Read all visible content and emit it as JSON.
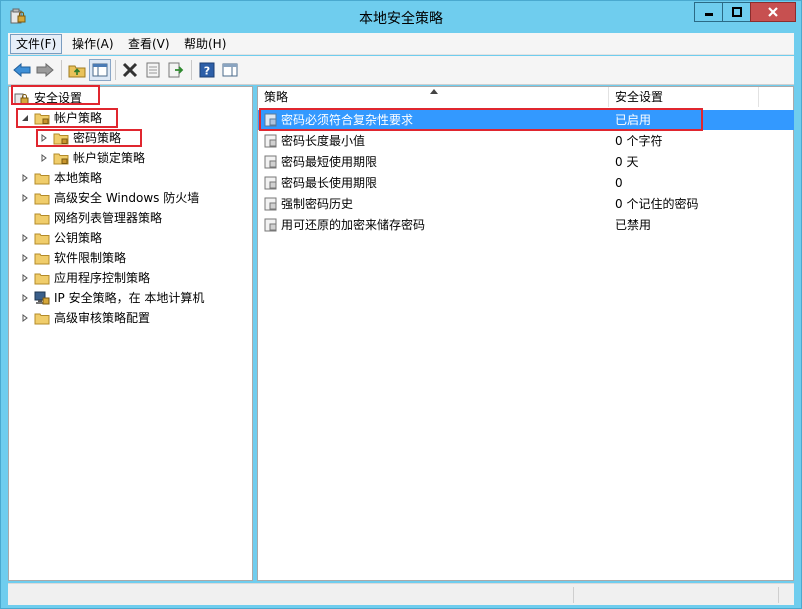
{
  "window": {
    "title": "本地安全策略"
  },
  "menu": [
    {
      "label": "文件(F)",
      "active": true
    },
    {
      "label": "操作(A)",
      "active": false
    },
    {
      "label": "查看(V)",
      "active": false
    },
    {
      "label": "帮助(H)",
      "active": false
    }
  ],
  "tree": {
    "root": "安全设置",
    "items": [
      {
        "label": "帐户策略",
        "expanded": true,
        "level": 1
      },
      {
        "label": "密码策略",
        "expanded": false,
        "level": 2,
        "selected": true
      },
      {
        "label": "帐户锁定策略",
        "expanded": false,
        "level": 2
      },
      {
        "label": "本地策略",
        "level": 1
      },
      {
        "label": "高级安全 Windows 防火墙",
        "level": 1
      },
      {
        "label": "网络列表管理器策略",
        "level": 1,
        "no_expander": true
      },
      {
        "label": "公钥策略",
        "level": 1
      },
      {
        "label": "软件限制策略",
        "level": 1
      },
      {
        "label": "应用程序控制策略",
        "level": 1
      },
      {
        "label": "IP 安全策略，在 本地计算机",
        "level": 1,
        "icon": "ip-security-icon"
      },
      {
        "label": "高级审核策略配置",
        "level": 1
      }
    ]
  },
  "list": {
    "columns": [
      "策略",
      "安全设置"
    ],
    "rows": [
      {
        "policy": "密码必须符合复杂性要求",
        "setting": "已启用",
        "selected": true
      },
      {
        "policy": "密码长度最小值",
        "setting": "0 个字符"
      },
      {
        "policy": "密码最短使用期限",
        "setting": "0 天"
      },
      {
        "policy": "密码最长使用期限",
        "setting": "0"
      },
      {
        "policy": "强制密码历史",
        "setting": "0 个记住的密码"
      },
      {
        "policy": "用可还原的加密来储存密码",
        "setting": "已禁用"
      }
    ]
  },
  "colors": {
    "frame": "#6fcdee",
    "selection": "#3399ff",
    "highlight_box": "#e0262f"
  }
}
